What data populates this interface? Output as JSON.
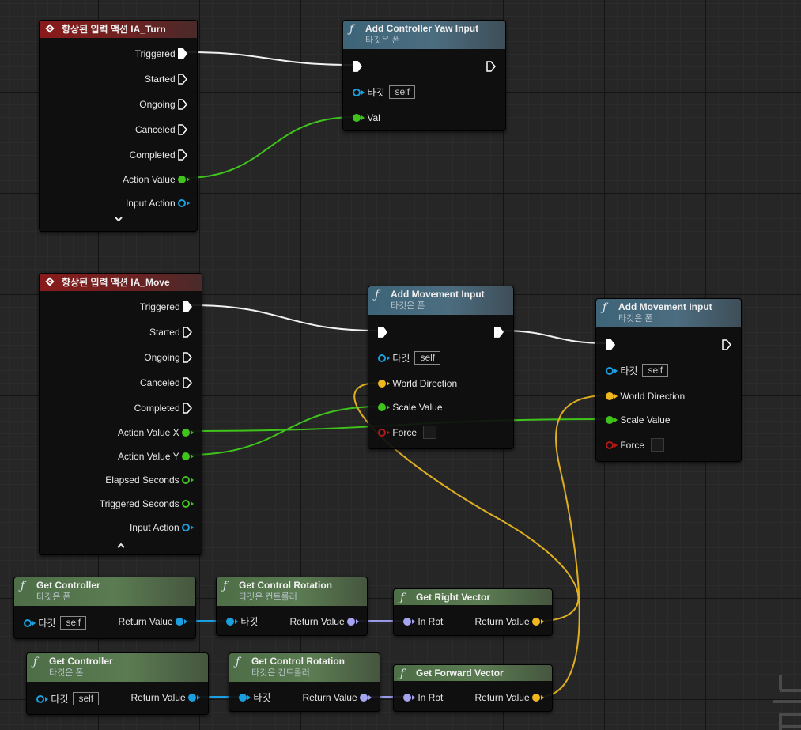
{
  "nodes": {
    "turn": {
      "title": "향상된 입력 액션 IA_Turn",
      "pins": [
        "Triggered",
        "Started",
        "Ongoing",
        "Canceled",
        "Completed",
        "Action Value",
        "Input Action"
      ]
    },
    "yaw": {
      "title": "Add Controller Yaw Input",
      "subtitle": "타깃은 폰",
      "target_label": "타깃",
      "target_value": "self",
      "val_label": "Val"
    },
    "move": {
      "title": "향상된 입력 액션 IA_Move",
      "pins": [
        "Triggered",
        "Started",
        "Ongoing",
        "Canceled",
        "Completed",
        "Action Value X",
        "Action Value Y",
        "Elapsed Seconds",
        "Triggered Seconds",
        "Input Action"
      ]
    },
    "movement1": {
      "title": "Add Movement Input",
      "subtitle": "타깃은 폰",
      "target_label": "타깃",
      "target_value": "self",
      "world_direction": "World Direction",
      "scale_value": "Scale Value",
      "force": "Force"
    },
    "movement2": {
      "title": "Add Movement Input",
      "subtitle": "타깃은 폰",
      "target_label": "타깃",
      "target_value": "self",
      "world_direction": "World Direction",
      "scale_value": "Scale Value",
      "force": "Force"
    },
    "get_controller_1": {
      "title": "Get Controller",
      "subtitle": "타깃은 폰",
      "target_label": "타깃",
      "target_value": "self",
      "return_label": "Return Value"
    },
    "get_rotation_1": {
      "title": "Get Control Rotation",
      "subtitle": "타깃은 컨트롤러",
      "target_label": "타깃",
      "return_label": "Return Value"
    },
    "get_right": {
      "title": "Get Right Vector",
      "in_label": "In Rot",
      "return_label": "Return Value"
    },
    "get_controller_2": {
      "title": "Get Controller",
      "subtitle": "타깃은 폰",
      "target_label": "타깃",
      "target_value": "self",
      "return_label": "Return Value"
    },
    "get_rotation_2": {
      "title": "Get Control Rotation",
      "subtitle": "타깃은 컨트롤러",
      "target_label": "타깃",
      "return_label": "Return Value"
    },
    "get_forward": {
      "title": "Get Forward Vector",
      "in_label": "In Rot",
      "return_label": "Return Value"
    }
  },
  "icons": {
    "event": "diamond-event-icon",
    "function": "function-f-icon",
    "expand": "chevron-down-icon",
    "collapse": "chevron-up-icon"
  },
  "colors": {
    "exec": "#f2f2f2",
    "float": "#3fc41c",
    "object": "#1aa0e0",
    "rotator": "#a4a4f0",
    "vector": "#f0b81c",
    "bool": "#b01818",
    "event_header": "#8a1a1a",
    "function_header": "#3d6478",
    "pure_header": "#4d6e46"
  }
}
